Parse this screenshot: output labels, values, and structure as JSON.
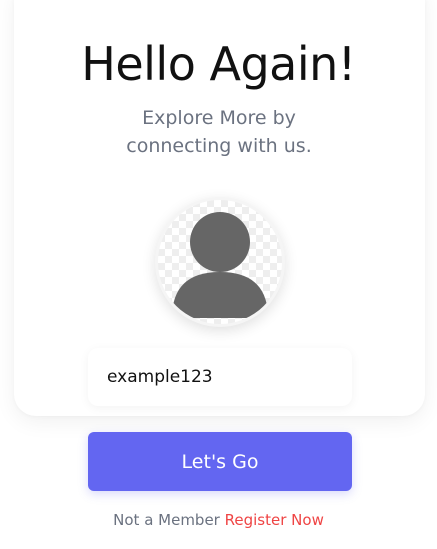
{
  "header": {
    "title": "Hello Again!",
    "subtitle": "Explore More by connecting with us."
  },
  "profile": {
    "avatar_icon": "user-icon",
    "avatar_color": "#666666"
  },
  "form": {
    "username_value": "example123",
    "submit_label": "Let's Go"
  },
  "footer": {
    "prompt": "Not a Member",
    "register_link": "Register Now"
  },
  "colors": {
    "accent": "#6366f1",
    "link": "#ef4444",
    "muted_text": "#6b7280"
  }
}
